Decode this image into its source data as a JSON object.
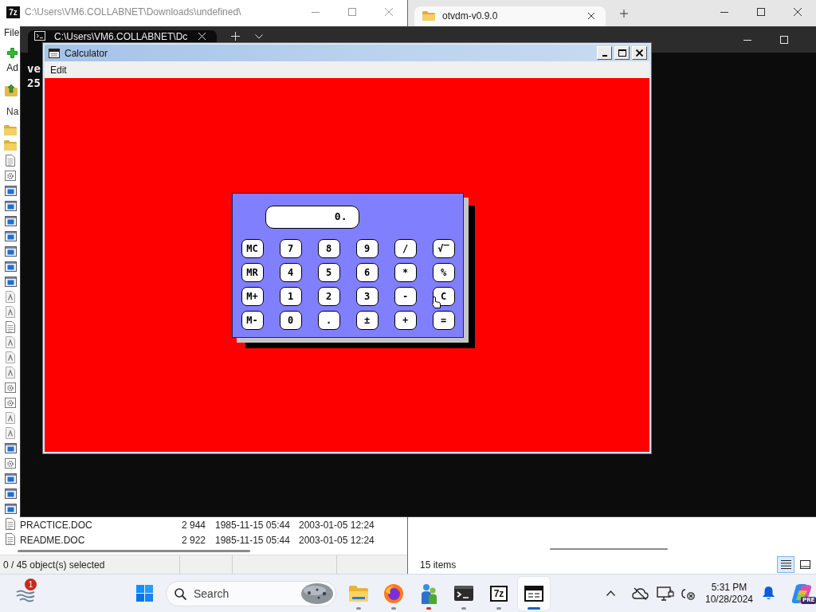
{
  "archive_window": {
    "logo": "7z",
    "title": "C:\\Users\\VM6.COLLABNET\\Downloads\\undefined\\",
    "menu": [
      "File"
    ],
    "toolbar": [
      "Ad"
    ],
    "columns": [
      "Na"
    ],
    "files": [
      {
        "kind": "folder"
      },
      {
        "kind": "folder"
      },
      {
        "kind": "text"
      },
      {
        "kind": "config"
      },
      {
        "kind": "program"
      },
      {
        "kind": "program"
      },
      {
        "kind": "program"
      },
      {
        "kind": "program"
      },
      {
        "kind": "program"
      },
      {
        "kind": "program"
      },
      {
        "kind": "program"
      },
      {
        "kind": "font"
      },
      {
        "kind": "font"
      },
      {
        "kind": "text"
      },
      {
        "kind": "font"
      },
      {
        "kind": "font"
      },
      {
        "kind": "font"
      },
      {
        "kind": "config"
      },
      {
        "kind": "config"
      },
      {
        "kind": "font"
      },
      {
        "kind": "font"
      },
      {
        "kind": "program"
      },
      {
        "kind": "config"
      },
      {
        "kind": "program"
      },
      {
        "kind": "program"
      },
      {
        "kind": "program"
      },
      {
        "kind": "text",
        "name": "PRACTICE.DOC",
        "size": "2 944",
        "modified": "1985-11-15 05:44",
        "created": "2003-01-05 12:24"
      },
      {
        "kind": "text",
        "name": "README.DOC",
        "size": "2 922",
        "modified": "1985-11-15 05:44",
        "created": "2003-01-05 12:24"
      }
    ],
    "status": "0 / 45 object(s) selected"
  },
  "explorer_window": {
    "tabs": [
      {
        "label": "otvdm-v0.9.0",
        "selected": true
      }
    ],
    "status": "15 items",
    "views": [
      {
        "kind": "details",
        "selected": true
      },
      {
        "kind": "tiles",
        "selected": false
      }
    ]
  },
  "terminal_window": {
    "tabs": [
      {
        "label": "C:\\Users\\VM6.COLLABNET\\Dc",
        "selected": true
      }
    ],
    "lines": [
      "ve",
      "25"
    ]
  },
  "calculator_window": {
    "title": "Calculator",
    "menu": [
      "Edit"
    ],
    "display": "0.",
    "keys": [
      "MC",
      "7",
      "8",
      "9",
      "/",
      "√‾",
      "MR",
      "4",
      "5",
      "6",
      "*",
      "%",
      "M+",
      "1",
      "2",
      "3",
      "-",
      "C",
      "M-",
      "0",
      ".",
      "±",
      "+",
      "="
    ]
  },
  "taskbar": {
    "widgets_badge": "1",
    "search": {
      "placeholder": "Search"
    },
    "apps": [
      {
        "kind": "files",
        "selected": false,
        "attention": false
      },
      {
        "kind": "browser",
        "selected": false,
        "attention": false
      },
      {
        "kind": "chat",
        "selected": false,
        "attention": true
      },
      {
        "kind": "terminal",
        "selected": false,
        "attention": false
      },
      {
        "kind": "archiver",
        "logo": "7z",
        "selected": false,
        "attention": false
      },
      {
        "kind": "calculator",
        "selected": true,
        "attention": false
      }
    ],
    "clock": {
      "time": "5:31 PM",
      "date": "10/28/2024"
    },
    "copilot_badge": "PRE"
  }
}
